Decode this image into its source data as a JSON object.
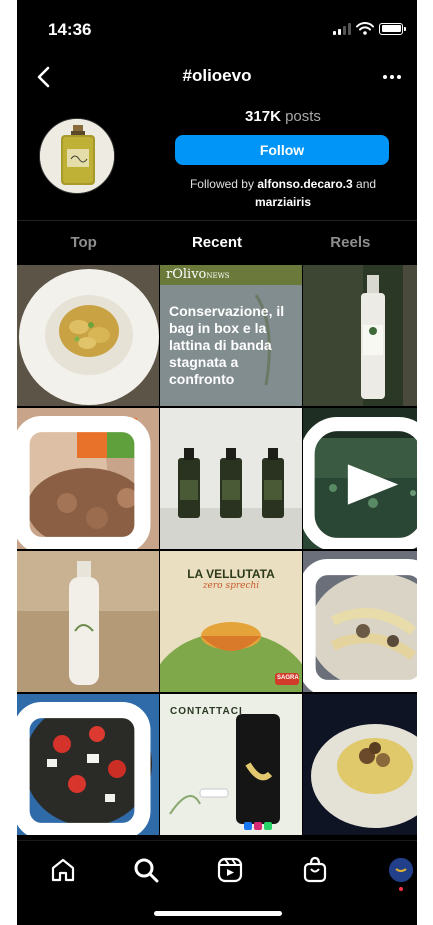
{
  "status_bar": {
    "time": "14:36"
  },
  "header": {
    "title": "#olioevo"
  },
  "profile": {
    "post_count": "317K",
    "post_label": "posts",
    "follow_label": "Follow",
    "followed_prefix": "Followed by",
    "followed_user_1": "alfonso.decaro.3",
    "followed_and": "and",
    "followed_user_2": "marziairis"
  },
  "tabs": [
    {
      "label": "Top"
    },
    {
      "label": "Recent",
      "active": true
    },
    {
      "label": "Reels"
    }
  ],
  "grid": {
    "news_logo": "rOlivo",
    "news_logo_sub": "NEWS",
    "news_headline": "Conservazione, il bag in box e la lattina di banda stagnata a confronto",
    "poster_title": "LA VELLUTATA",
    "poster_subtitle": "zero sprechi",
    "poster_brand": "SAGRA",
    "contact_title": "CONTATTACI"
  },
  "colors": {
    "accent": "#0095f6",
    "background": "#000000",
    "muted_text": "#8e8e8e",
    "notification_dot": "#ff3040"
  },
  "icons": {
    "back": "chevron-left-icon",
    "more": "more-horizontal-icon",
    "home": "home-icon",
    "search": "search-icon",
    "reels": "reels-icon",
    "shop": "shopping-bag-icon"
  }
}
